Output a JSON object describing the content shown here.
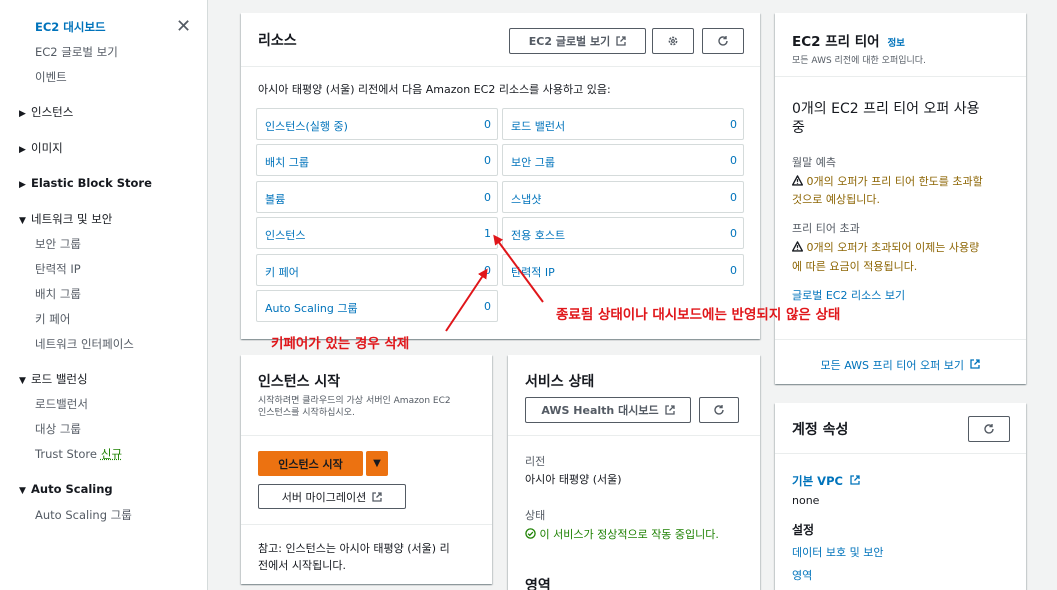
{
  "sidebar": {
    "items": [
      {
        "label": "EC2 대시보드"
      },
      {
        "label": "EC2 글로벌 보기"
      },
      {
        "label": "이벤트"
      }
    ],
    "sections": [
      {
        "label": "인스턴스",
        "open": false
      },
      {
        "label": "이미지",
        "open": false
      },
      {
        "label": "Elastic Block Store",
        "open": false
      },
      {
        "label": "네트워크 및 보안",
        "open": true,
        "children": [
          "보안 그룹",
          "탄력적 IP",
          "배치 그룹",
          "키 페어",
          "네트워크 인터페이스"
        ]
      },
      {
        "label": "로드 밸런싱",
        "open": true,
        "children": [
          "로드밸런서",
          "대상 그룹",
          "Trust Store"
        ]
      },
      {
        "label": "Auto Scaling",
        "open": true,
        "children": [
          "Auto Scaling 그룹"
        ]
      }
    ],
    "new_badge": "신규"
  },
  "resources": {
    "title": "리소스",
    "global_view_btn": "EC2 글로벌 보기",
    "description": "아시아 태평양 (서울) 리전에서 다음 Amazon EC2 리소스를 사용하고 있음:",
    "left": [
      {
        "name": "인스턴스(실행 중)",
        "count": "0"
      },
      {
        "name": "배치 그룹",
        "count": "0"
      },
      {
        "name": "볼륨",
        "count": "0"
      },
      {
        "name": "인스턴스",
        "count": "1"
      },
      {
        "name": "키 페어",
        "count": "0"
      },
      {
        "name": "Auto Scaling 그룹",
        "count": "0"
      }
    ],
    "right": [
      {
        "name": "로드 밸런서",
        "count": "0"
      },
      {
        "name": "보안 그룹",
        "count": "0"
      },
      {
        "name": "스냅샷",
        "count": "0"
      },
      {
        "name": "전용 호스트",
        "count": "0"
      },
      {
        "name": "탄력적 IP",
        "count": "0"
      }
    ]
  },
  "annotations": {
    "keypair_note": "키페어가 있는 경우 삭제",
    "instance_note": "종료됨 상태이나 대시보드에는 반영되지 않은 상태",
    "color": "#e0161a"
  },
  "launch": {
    "title": "인스턴스 시작",
    "desc_line1": "시작하려면 클라우드의 가상 서버인 Amazon EC2",
    "desc_line2": "인스턴스를 시작하십시오.",
    "launch_btn": "인스턴스 시작",
    "migrate_btn": "서버 마이그레이션",
    "note_line1": "참고: 인스턴스는 아시아 태평양 (서울) 리",
    "note_line2": "전에서 시작됩니다."
  },
  "service": {
    "title": "서비스 상태",
    "health_btn": "AWS Health 대시보드",
    "region_label": "리전",
    "region_value": "아시아 태평양 (서울)",
    "status_label": "상태",
    "status_value": "이 서비스가 정상적으로 작동 중입니다.",
    "zone_label": "영역"
  },
  "free_tier": {
    "title": "EC2 프리 티어",
    "info": "정보",
    "subtitle": "모든 AWS 리전에 대한 오퍼입니다.",
    "heading_line1": "0개의 EC2 프리 티어 오퍼 사용",
    "heading_line2": "중",
    "forecast_label": "월말 예측",
    "forecast_line1": "0개의 오퍼가 프리 티어 한도를 초과할",
    "forecast_line2": "것으로 예상됩니다.",
    "exceeded_label": "프리 티어 초과",
    "exceeded_line1": "0개의 오퍼가 초과되어 이제는 사용량",
    "exceeded_line2": "에 따른 요금이 적용됩니다.",
    "global_link": "글로벌 EC2 리소스 보기",
    "all_offers_link": "모든 AWS 프리 티어 오퍼 보기"
  },
  "account": {
    "title": "계정 속성",
    "default_vpc_label": "기본 VPC",
    "default_vpc_value": "none",
    "settings_label": "설정",
    "data_protection": "데이터 보호 및 보안",
    "zone": "영역"
  }
}
